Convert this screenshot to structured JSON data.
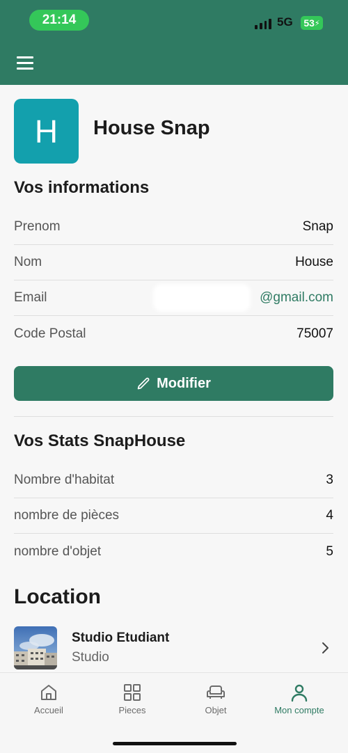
{
  "status_bar": {
    "time": "21:14",
    "network": "5G",
    "battery": "53"
  },
  "profile": {
    "initial": "H",
    "name": "House Snap"
  },
  "info": {
    "title": "Vos informations",
    "rows": [
      {
        "label": "Prenom",
        "value": "Snap"
      },
      {
        "label": "Nom",
        "value": "House"
      },
      {
        "label": "Email",
        "value": "@gmail.com"
      },
      {
        "label": "Code Postal",
        "value": "75007"
      }
    ],
    "modify_label": "Modifier"
  },
  "stats": {
    "title": "Vos Stats SnapHouse",
    "rows": [
      {
        "label": "Nombre d'habitat",
        "value": "3"
      },
      {
        "label": "nombre de pièces",
        "value": "4"
      },
      {
        "label": "nombre d'objet",
        "value": "5"
      }
    ]
  },
  "location": {
    "title": "Location",
    "items": [
      {
        "title": "Studio Etudiant",
        "subtitle": "Studio"
      }
    ]
  },
  "tabs": [
    {
      "label": "Accueil",
      "icon": "home-icon",
      "active": false
    },
    {
      "label": "Pieces",
      "icon": "grid-icon",
      "active": false
    },
    {
      "label": "Objet",
      "icon": "armchair-icon",
      "active": false
    },
    {
      "label": "Mon compte",
      "icon": "user-icon",
      "active": true
    }
  ],
  "colors": {
    "primary": "#2f7b63",
    "avatar": "#13a0ad",
    "status_pill": "#34c759"
  }
}
